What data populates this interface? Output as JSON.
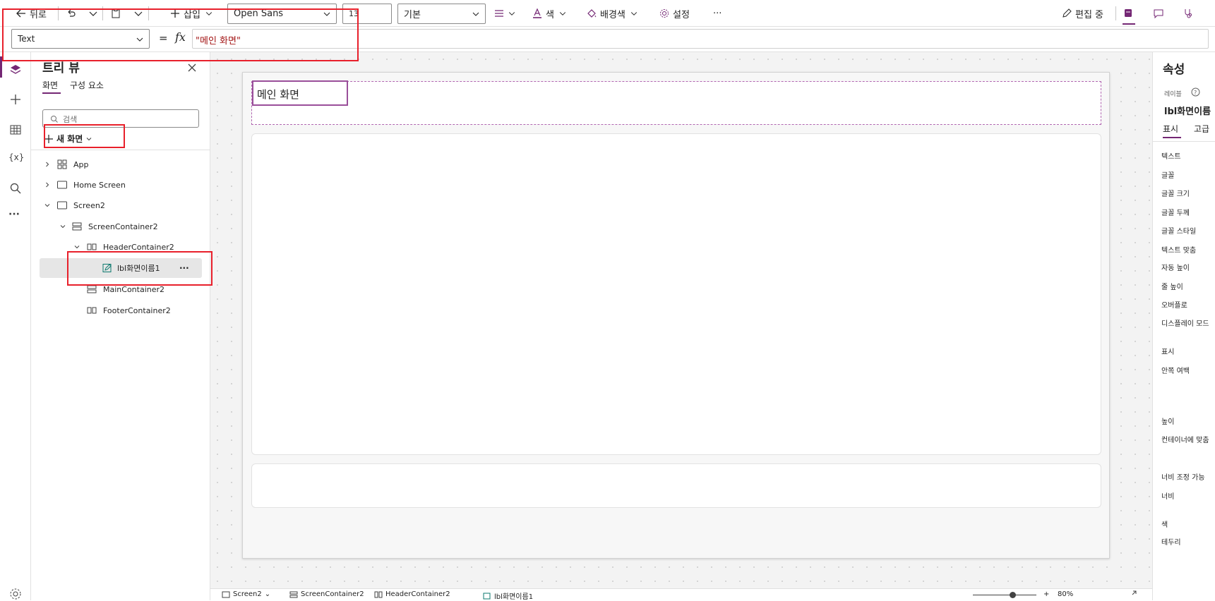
{
  "toolbar": {
    "back_label": "뒤로",
    "insert_label": "삽입",
    "font_value": "Open Sans",
    "font_size_value": "13",
    "weight_value": "기본",
    "color_label": "색",
    "bgcolor_label": "배경색",
    "settings_label": "설정",
    "more_label": "···",
    "editing_label": "편집 중"
  },
  "formula": {
    "property_value": "Text",
    "equals": "=",
    "fx": "fx",
    "value": "\"메인 화면\""
  },
  "tree": {
    "title": "트리 뷰",
    "tabs": [
      "화면",
      "구성 요소"
    ],
    "search_placeholder": "검색",
    "new_screen_label": "새 화면",
    "items": [
      {
        "label": "App"
      },
      {
        "label": "Home Screen"
      },
      {
        "label": "Screen2"
      },
      {
        "label": "ScreenContainer2"
      },
      {
        "label": "HeaderContainer2"
      },
      {
        "label": "lbl화면이름1"
      },
      {
        "label": "MainContainer2"
      },
      {
        "label": "FooterContainer2"
      }
    ],
    "row_more": "···"
  },
  "canvas": {
    "label_text": "메인 화면"
  },
  "props": {
    "title": "속성",
    "type_label": "레이블",
    "control_name": "lbl화면이름",
    "tabs": [
      "표시",
      "고급"
    ],
    "rows": [
      "텍스트",
      "글꼴",
      "글꼴 크기",
      "글꼴 두께",
      "글꼴 스타일",
      "텍스트 맞춤",
      "자동 높이",
      "줄 높이",
      "오버플로",
      "디스플레이 모드",
      "표시",
      "안쪽 여백",
      "높이",
      "컨테이너에 맞춤",
      "너비 조정 가능",
      "너비",
      "색",
      "테두리"
    ]
  },
  "statusbar": {
    "crumbs": [
      "Screen2",
      "ScreenContainer2",
      "HeaderContainer2",
      "lbl화면이름1"
    ],
    "zoom": "80%"
  },
  "colors": {
    "accent": "#742774",
    "highlight": "#e8202b",
    "formula_text": "#a31515"
  }
}
